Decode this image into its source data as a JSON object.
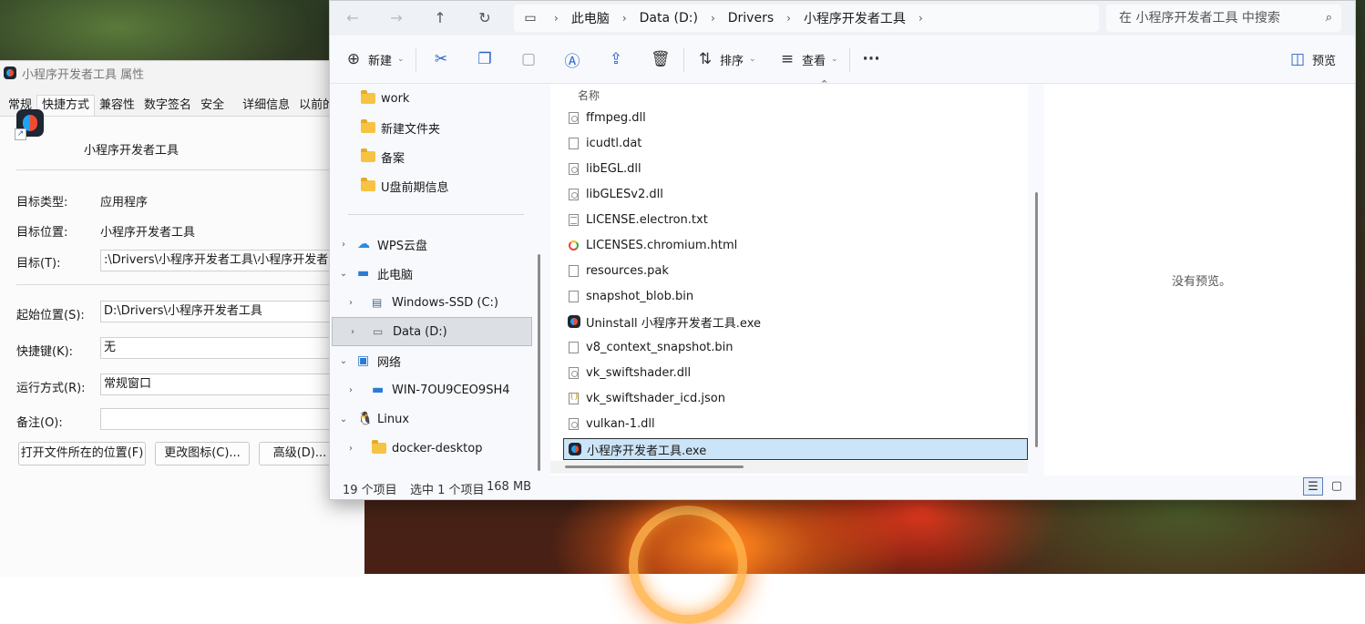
{
  "properties": {
    "title": "小程序开发者工具 属性",
    "tabs": [
      "常规",
      "快捷方式",
      "兼容性",
      "数字签名",
      "安全",
      "详细信息",
      "以前的"
    ],
    "name": "小程序开发者工具",
    "target_type_label": "目标类型:",
    "target_type_value": "应用程序",
    "target_location_label": "目标位置:",
    "target_location_value": "小程序开发者工具",
    "target_label": "目标(T):",
    "target_value": ":\\Drivers\\小程序开发者工具\\小程序开发者工具",
    "start_in_label": "起始位置(S):",
    "start_in_value": "D:\\Drivers\\小程序开发者工具",
    "hotkey_label": "快捷键(K):",
    "hotkey_value": "无",
    "run_label": "运行方式(R):",
    "run_value": "常规窗口",
    "comment_label": "备注(O):",
    "comment_value": "",
    "btn_open_location": "打开文件所在的位置(F)",
    "btn_change_icon": "更改图标(C)...",
    "btn_advanced": "高级(D)..."
  },
  "explorer": {
    "breadcrumb": [
      "此电脑",
      "Data (D:)",
      "Drivers",
      "小程序开发者工具"
    ],
    "search_placeholder": "在 小程序开发者工具 中搜索",
    "toolbar": {
      "new": "新建",
      "sort": "排序",
      "view": "查看",
      "preview": "预览"
    },
    "nav": [
      {
        "label": "work",
        "icon": "folder-icon"
      },
      {
        "label": "新建文件夹",
        "icon": "folder-icon"
      },
      {
        "label": "备案",
        "icon": "folder-icon"
      },
      {
        "label": "U盘前期信息",
        "icon": "folder-icon"
      },
      {
        "label": "WPS云盘",
        "icon": "cloud-icon"
      },
      {
        "label": "此电脑",
        "icon": "computer-icon"
      },
      {
        "label": "Windows-SSD (C:)",
        "icon": "drive-icon"
      },
      {
        "label": "Data (D:)",
        "icon": "drive-icon"
      },
      {
        "label": "网络",
        "icon": "network-icon"
      },
      {
        "label": "WIN-7OU9CEO9SH4",
        "icon": "computer-icon"
      },
      {
        "label": "Linux",
        "icon": "linux-icon"
      },
      {
        "label": "docker-desktop",
        "icon": "folder-icon"
      }
    ],
    "column_name": "名称",
    "files": [
      {
        "name": "ffmpeg.dll",
        "type": "dll"
      },
      {
        "name": "icudtl.dat",
        "type": "file"
      },
      {
        "name": "libEGL.dll",
        "type": "dll"
      },
      {
        "name": "libGLESv2.dll",
        "type": "dll"
      },
      {
        "name": "LICENSE.electron.txt",
        "type": "txt"
      },
      {
        "name": "LICENSES.chromium.html",
        "type": "html"
      },
      {
        "name": "resources.pak",
        "type": "file"
      },
      {
        "name": "snapshot_blob.bin",
        "type": "file"
      },
      {
        "name": "Uninstall 小程序开发者工具.exe",
        "type": "exe"
      },
      {
        "name": "v8_context_snapshot.bin",
        "type": "file"
      },
      {
        "name": "vk_swiftshader.dll",
        "type": "dll"
      },
      {
        "name": "vk_swiftshader_icd.json",
        "type": "json"
      },
      {
        "name": "vulkan-1.dll",
        "type": "dll"
      },
      {
        "name": "小程序开发者工具.exe",
        "type": "exe",
        "selected": true
      }
    ],
    "no_preview": "没有预览。",
    "status": {
      "count": "19 个项目",
      "selected": "选中 1 个项目",
      "size": "168 MB"
    }
  }
}
